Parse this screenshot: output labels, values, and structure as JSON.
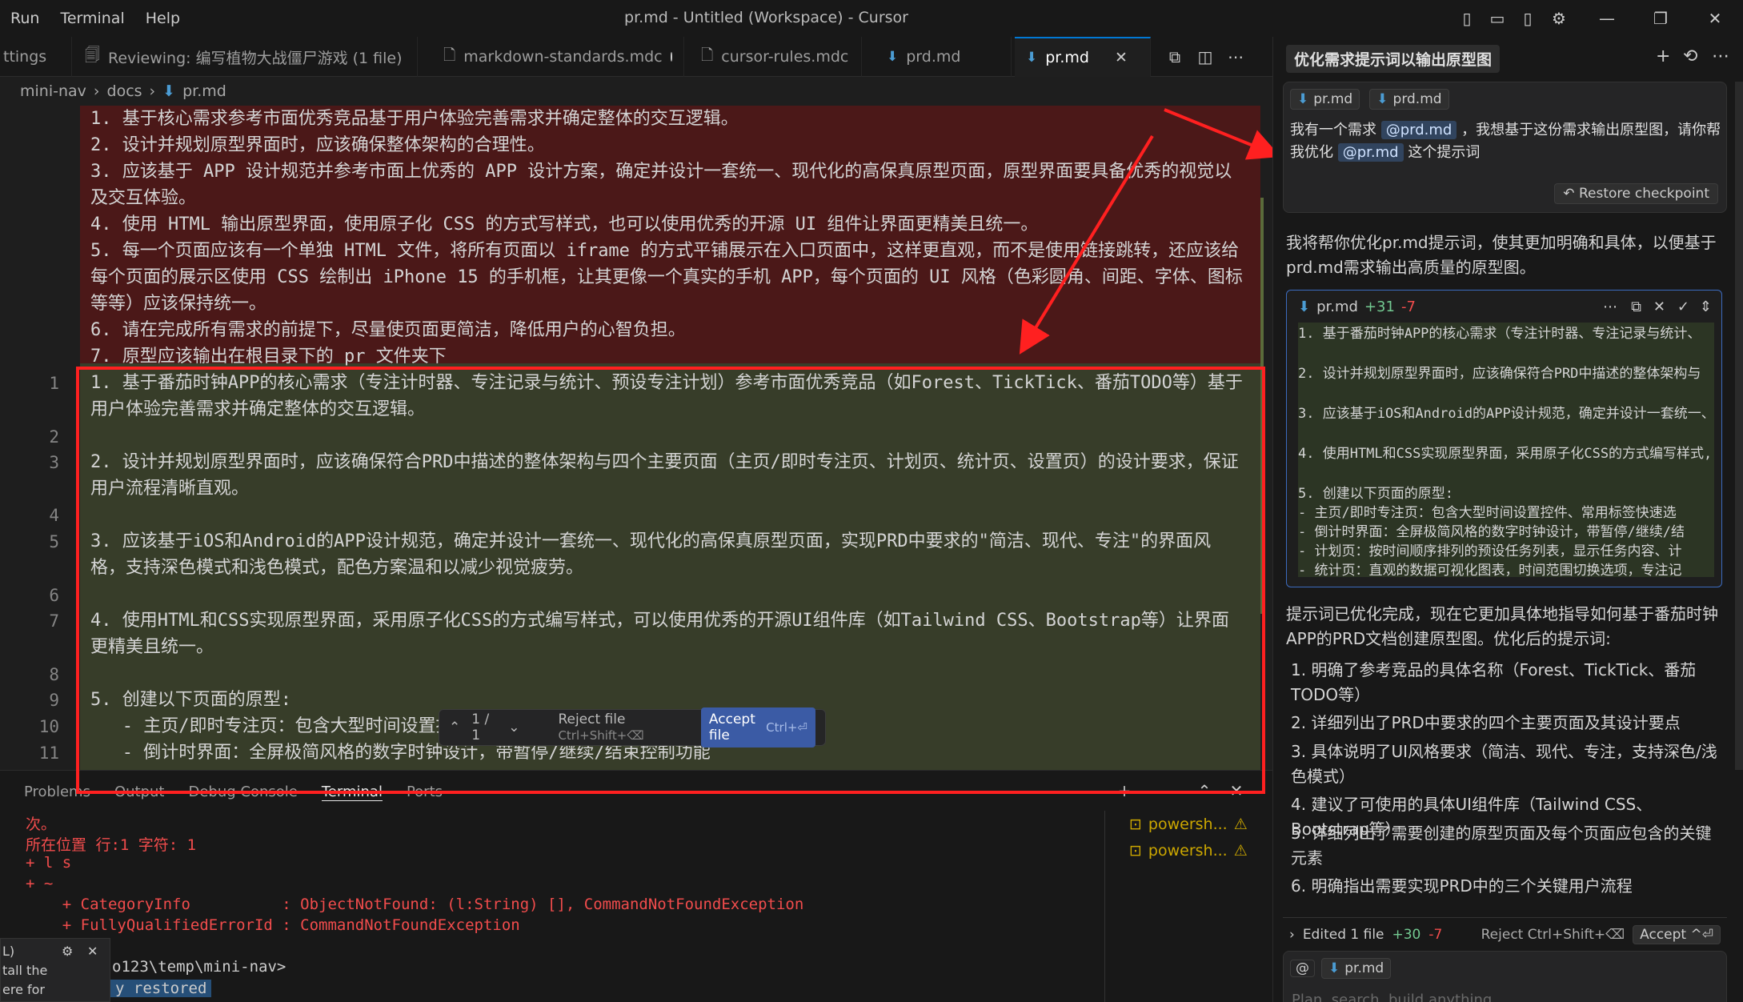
{
  "window": {
    "title": "pr.md - Untitled (Workspace) - Cursor",
    "menu": [
      "Run",
      "Terminal",
      "Help"
    ]
  },
  "tabs": [
    {
      "label": "ttings",
      "icon": "settings-icon"
    },
    {
      "label": "Reviewing: 编写植物大战僵尸游戏 (1 file)",
      "icon": "preview-icon"
    },
    {
      "label": "markdown-standards.mdc",
      "icon": "file-icon",
      "modified": true
    },
    {
      "label": "cursor-rules.mdc",
      "icon": "file-icon"
    },
    {
      "label": "prd.md",
      "icon": "markdown-icon"
    },
    {
      "label": "pr.md",
      "icon": "markdown-icon",
      "active": true
    }
  ],
  "breadcrumb": [
    "mini-nav",
    "docs",
    "pr.md"
  ],
  "editor": {
    "removed_lines": [
      "1. 基于核心需求参考市面优秀竞品基于用户体验完善需求并确定整体的交互逻辑。",
      "2. 设计并规划原型界面时，应该确保整体架构的合理性。",
      "3. 应该基于 APP 设计规范并参考市面上优秀的 APP 设计方案，确定并设计一套统一、现代化的高保真原型页面，原型界面要具备优秀的视觉以及交互体验。",
      "4. 使用 HTML 输出原型界面，使用原子化 CSS 的方式写样式，也可以使用优秀的开源 UI 组件让界面更精美且统一。",
      "5. 每一个页面应该有一个单独 HTML 文件，将所有页面以 iframe 的方式平铺展示在入口页面中，这样更直观，而不是使用链接跳转，还应该给每个页面的展示区使用 CSS 绘制出 iPhone 15 的手机框，让其更像一个真实的手机 APP，每个页面的 UI 风格（色彩圆角、间距、字体、图标等等）应该保持统一。",
      "6. 请在完成所有需求的前提下，尽量使页面更简洁，降低用户的心智负担。",
      "7. 原型应该输出在根目录下的 pr 文件夹下"
    ],
    "added_lines": [
      {
        "num": "1",
        "text": "1. 基于番茄时钟APP的核心需求（专注计时器、专注记录与统计、预设专注计划）参考市面优秀竞品（如Forest、TickTick、番茄TODO等）基于用户体验完善需求并确定整体的交互逻辑。"
      },
      {
        "num": "2",
        "text": ""
      },
      {
        "num": "3",
        "text": "2. 设计并规划原型界面时，应该确保符合PRD中描述的整体架构与四个主要页面（主页/即时专注页、计划页、统计页、设置页）的设计要求，保证用户流程清晰直观。"
      },
      {
        "num": "4",
        "text": ""
      },
      {
        "num": "5",
        "text": "3. 应该基于iOS和Android的APP设计规范，确定并设计一套统一、现代化的高保真原型页面，实现PRD中要求的\"简洁、现代、专注\"的界面风格，支持深色模式和浅色模式，配色方案温和以减少视觉疲劳。"
      },
      {
        "num": "6",
        "text": ""
      },
      {
        "num": "7",
        "text": "4. 使用HTML和CSS实现原型界面，采用原子化CSS的方式编写样式，可以使用优秀的开源UI组件库（如Tailwind CSS、Bootstrap等）让界面更精美且统一。"
      },
      {
        "num": "8",
        "text": ""
      },
      {
        "num": "9",
        "text": "5. 创建以下页面的原型:"
      },
      {
        "num": "10",
        "text": "   - 主页/即时专注页：包含大型时间设置控件、常用标签快速选择、今日专注摘要"
      },
      {
        "num": "11",
        "text": "   - 倒计时界面：全屏极简风格的数字时钟设计，带暂停/继续/结束控制功能"
      }
    ]
  },
  "diff_bar": {
    "counter": "1 / 1",
    "reject_label": "Reject file",
    "reject_kbd": "Ctrl+Shift+⌫",
    "accept_label": "Accept file",
    "accept_kbd": "Ctrl+⏎"
  },
  "panel": {
    "tabs": [
      "Problems",
      "Output",
      "Debug Console",
      "Terminal",
      "Ports"
    ],
    "terminal_lines": [
      "次。",
      "所在位置 行:1 字符: 1",
      "+ l s",
      "+ ~",
      "    + CategoryInfo          : ObjectNotFound: (l:String) [], CommandNotFoundException",
      "    + FullyQualifiedErrorId : CommandNotFoundException",
      "",
      "o123\\temp\\mini-nav>"
    ],
    "terminals": [
      "powersh...",
      "powersh..."
    ],
    "restored_label": "y restored"
  },
  "notification": {
    "lines": [
      "L)",
      "tall the",
      "ere for"
    ]
  },
  "chat": {
    "title": "优化需求提示词以输出原型图",
    "context_pills": [
      "pr.md",
      "prd.md"
    ],
    "user_message_parts": [
      "我有一个需求",
      "@prd.md",
      "，我想基于这份需求输出原型图，请你帮我优化",
      "@pr.md",
      "这个提示词"
    ],
    "restore_label": "Restore checkpoint",
    "assistant_intro": "我将帮你优化pr.md提示词，使其更加明确和具体，以便基于prd.md需求输出高质量的原型图。",
    "diff_card": {
      "file": "pr.md",
      "added": "+31",
      "removed": "-7",
      "lines": [
        "1. 基于番茄时钟APP的核心需求（专注计时器、专注记录与统计、",
        "",
        "2. 设计并规划原型界面时，应该确保符合PRD中描述的整体架构与",
        "",
        "3. 应该基于iOS和Android的APP设计规范，确定并设计一套统一、",
        "",
        "4. 使用HTML和CSS实现原型界面，采用原子化CSS的方式编写样式,",
        "",
        "5. 创建以下页面的原型:",
        "   - 主页/即时专注页：包含大型时间设置控件、常用标签快速选",
        "   - 倒计时界面：全屏极简风格的数字时钟设计，带暂停/继续/结",
        "   - 计划页：按时间顺序排列的预设任务列表，显示任务内容、计",
        "   - 统计页：直观的数据可视化图表，时间范围切换选项，专注记"
      ]
    },
    "assistant_summary": "提示词已优化完成，现在它更加具体地指导如何基于番茄时钟APP的PRD文档创建原型图。优化后的提示词:",
    "summary_items": [
      "1. 明确了参考竞品的具体名称（Forest、TickTick、番茄TODO等）",
      "2. 详细列出了PRD中要求的四个主要页面及其设计要点",
      "3. 具体说明了UI风格要求（简洁、现代、专注，支持深色/浅色模式）",
      "4. 建议了可使用的具体UI组件库（Tailwind CSS、Bootstrap等）",
      "5. 详细列出了需要创建的原型页面及每个页面应包含的关键元素",
      "6. 明确指出需要实现PRD中的三个关键用户流程"
    ],
    "edited_bar": {
      "label": "Edited 1 file",
      "added": "+30",
      "removed": "-7",
      "reject": "Reject Ctrl+Shift+⌫",
      "accept": "Accept ^⏎"
    },
    "input_pill": "pr.md",
    "input_placeholder": "Plan, search, build anything"
  },
  "colors": {
    "annotation_red": "#ff2020",
    "removed_bg": "#4b1818",
    "added_bg": "#373d29",
    "accent": "#0078d4"
  }
}
